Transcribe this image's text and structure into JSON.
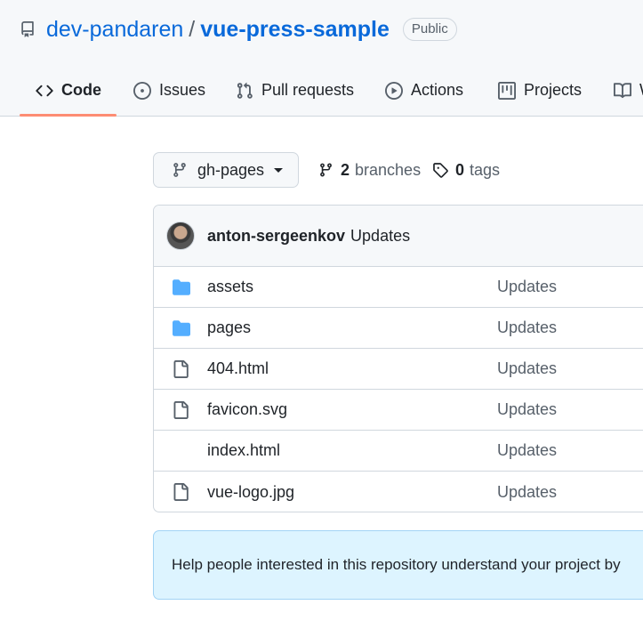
{
  "repo": {
    "owner": "dev-pandaren",
    "separator": "/",
    "name": "vue-press-sample",
    "visibility": "Public"
  },
  "tabs": [
    {
      "label": "Code",
      "icon": "code-icon",
      "selected": true
    },
    {
      "label": "Issues",
      "icon": "issue-icon"
    },
    {
      "label": "Pull requests",
      "icon": "pull-request-icon"
    },
    {
      "label": "Actions",
      "icon": "play-icon"
    },
    {
      "label": "Projects",
      "icon": "project-icon"
    },
    {
      "label": "W",
      "icon": "book-icon"
    }
  ],
  "branch": {
    "current": "gh-pages",
    "branches_count": "2",
    "branches_label": "branches",
    "tags_count": "0",
    "tags_label": "tags"
  },
  "commit": {
    "author": "anton-sergeenkov",
    "message": "Updates"
  },
  "files": [
    {
      "name": "assets",
      "type": "folder",
      "message": "Updates"
    },
    {
      "name": "pages",
      "type": "folder",
      "message": "Updates"
    },
    {
      "name": "404.html",
      "type": "file",
      "message": "Updates"
    },
    {
      "name": "favicon.svg",
      "type": "file",
      "message": "Updates"
    },
    {
      "name": "index.html",
      "type": "file",
      "message": "Updates"
    },
    {
      "name": "vue-logo.jpg",
      "type": "file",
      "message": "Updates"
    }
  ],
  "readme_banner": {
    "text": "Help people interested in this repository understand your project by"
  },
  "colors": {
    "link": "#0969da",
    "folder": "#54aeff",
    "tab_underline": "#fd8c73",
    "banner_bg": "#ddf4ff"
  }
}
